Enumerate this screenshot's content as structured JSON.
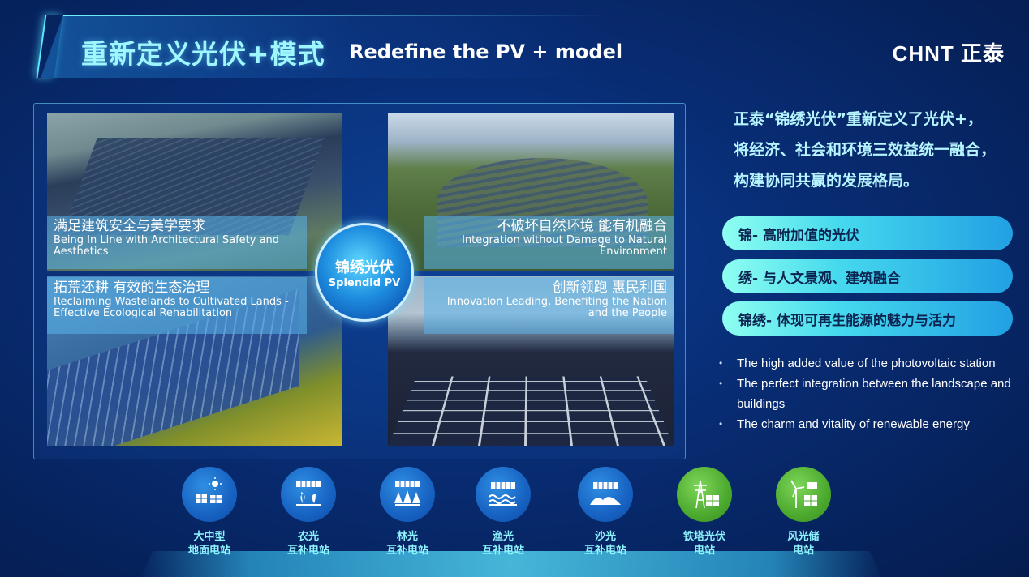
{
  "header": {
    "title_cn": "重新定义光伏+模式",
    "title_en": "Redefine the PV + model",
    "brand": "CHNT 正泰"
  },
  "center_badge": {
    "cn": "锦绣光伏",
    "en": "Splendid PV"
  },
  "captions": [
    {
      "cn": "满足建筑安全与美学要求",
      "en": "Being In Line with Architectural Safety and Aesthetics"
    },
    {
      "cn": "拓荒还耕 有效的生态治理",
      "en": "Reclaiming Wastelands to Cultivated Lands - Effective Ecological Rehabilitation"
    },
    {
      "cn": "不破坏自然环境 能有机融合",
      "en": "Integration without Damage to Natural Environment"
    },
    {
      "cn": "创新领跑 惠民利国",
      "en": "Innovation Leading, Benefiting the Nation and the People"
    }
  ],
  "intro": {
    "line1": "正泰“锦绣光伏”重新定义了光伏+，",
    "line2": "将经济、社会和环境三效益统一融合，",
    "line3": "构建协同共赢的发展格局。"
  },
  "pills": [
    "锦- 高附加值的光伏",
    "绣- 与人文景观、建筑融合",
    "锦绣- 体现可再生能源的魅力与活力"
  ],
  "bullets": [
    "The high added value of the photovoltaic station",
    "The perfect integration between the landscape and buildings",
    "The charm and vitality of renewable energy"
  ],
  "stations": [
    {
      "line1": "大中型",
      "line2": "地面电站",
      "icon": "ground-solar-icon",
      "color": "#1762c2"
    },
    {
      "line1": "农光",
      "line2": "互补电站",
      "icon": "agri-solar-icon",
      "color": "#1762c2"
    },
    {
      "line1": "林光",
      "line2": "互补电站",
      "icon": "forest-solar-icon",
      "color": "#1762c2"
    },
    {
      "line1": "渔光",
      "line2": "互补电站",
      "icon": "fishery-solar-icon",
      "color": "#1762c2"
    },
    {
      "line1": "沙光",
      "line2": "互补电站",
      "icon": "desert-solar-icon",
      "color": "#1762c2"
    },
    {
      "line1": "铁塔光伏",
      "line2": "电站",
      "icon": "tower-solar-icon",
      "color": "#4caa2e"
    },
    {
      "line1": "风光储",
      "line2": "电站",
      "icon": "wind-solar-storage-icon",
      "color": "#4caa2e"
    }
  ]
}
